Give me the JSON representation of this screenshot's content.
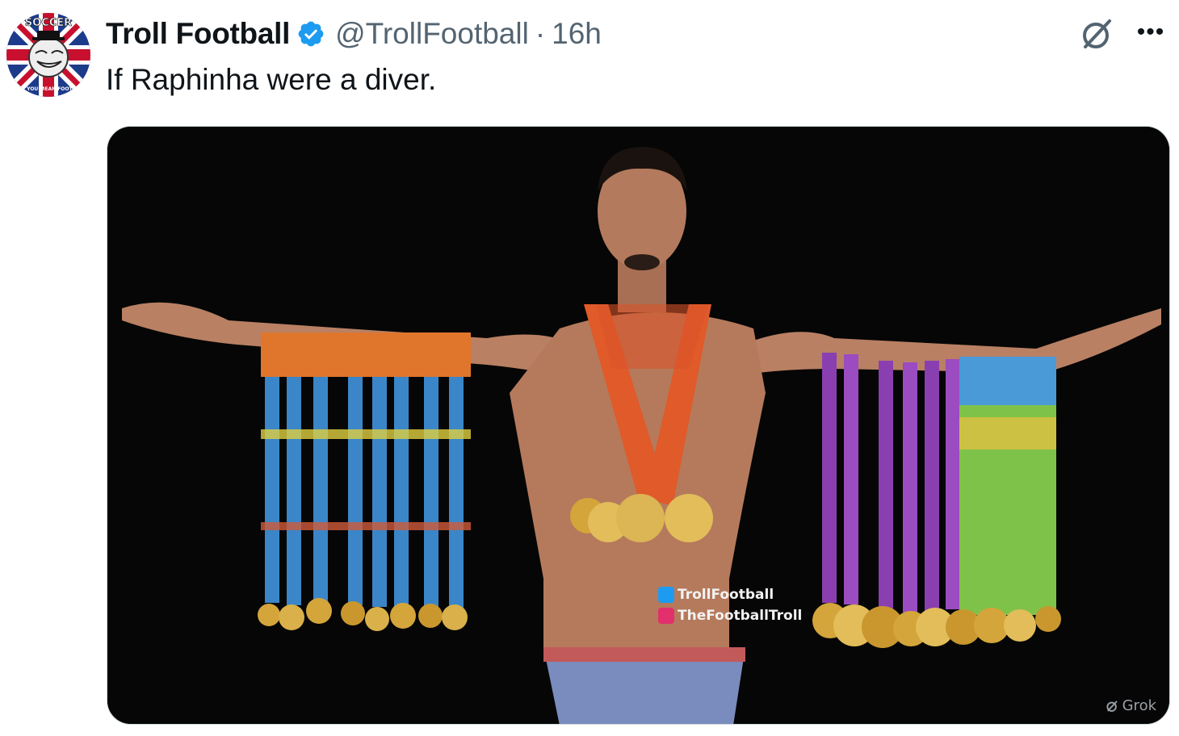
{
  "author": {
    "display_name": "Troll Football",
    "handle": "@TrollFootball",
    "separator": "·",
    "time": "16h",
    "verified": true,
    "avatar_text_top": "SOCCER",
    "avatar_text_bottom": "DON'T YOU MEAN FOOTBALL?"
  },
  "tweet": {
    "text": "If Raphinha were a diver."
  },
  "actions": {
    "grok_icon": "grok-slash-circle-icon",
    "more_icon": "ellipsis-icon",
    "more_label": "•••"
  },
  "media": {
    "watermark_twitter": "TrollFootball",
    "watermark_instagram": "TheFootballTroll",
    "grok_watermark": "Grok"
  },
  "colors": {
    "verified_blue": "#1d9bf0",
    "text_primary": "#0f1419",
    "text_secondary": "#536471",
    "media_border": "#cfd9de"
  }
}
